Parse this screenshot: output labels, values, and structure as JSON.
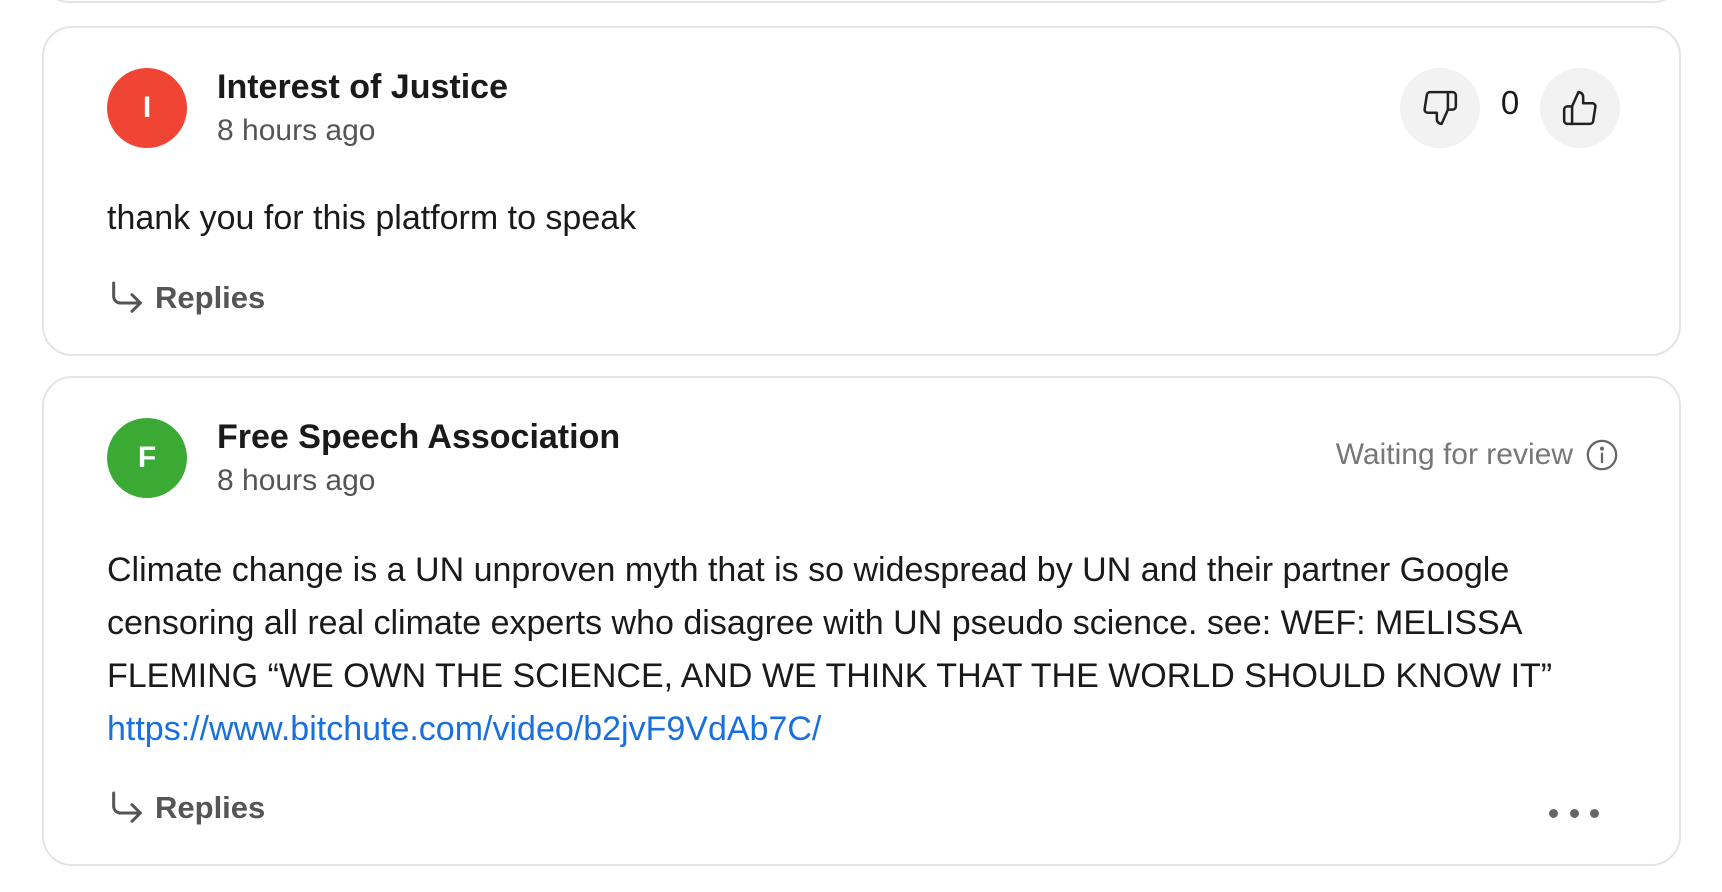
{
  "comments": [
    {
      "author": "Interest of Justice",
      "avatar_letter": "I",
      "avatar_color": "#f04535",
      "time": "8 hours ago",
      "text": "thank you for this platform to speak",
      "vote_count": "0",
      "replies_label": "Replies"
    },
    {
      "author": "Free Speech Association",
      "avatar_letter": "F",
      "avatar_color": "#3aaa35",
      "time": "8 hours ago",
      "text": "Climate change is a UN unproven myth that is so widespread by UN and their partner Google censoring all real climate experts who disagree with UN pseudo science. see: WEF: MELISSA FLEMING “WE OWN THE SCIENCE, AND WE THINK THAT THE WORLD SHOULD KNOW IT” ",
      "link": "https://www.bitchute.com/video/b2jvF9VdAb7C/",
      "status": "Waiting for review",
      "replies_label": "Replies"
    }
  ],
  "colors": {
    "link": "#1a6fde",
    "card_border": "#e4e4e6",
    "vote_button_bg": "#f2f2f3"
  },
  "icons": {
    "thumbs_down": "thumbs-down-icon",
    "thumbs_up": "thumbs-up-icon",
    "reply_arrow": "reply-arrow-icon",
    "info": "info-icon",
    "more": "more-icon"
  }
}
